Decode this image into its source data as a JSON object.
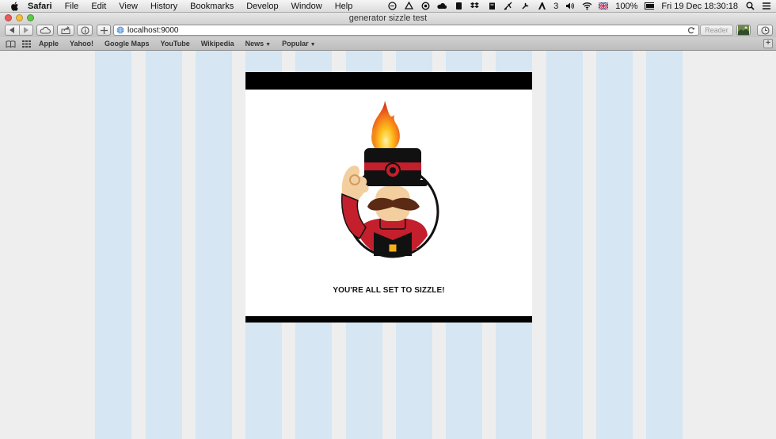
{
  "menubar": {
    "app": "Safari",
    "items": [
      "File",
      "Edit",
      "View",
      "History",
      "Bookmarks",
      "Develop",
      "Window",
      "Help"
    ],
    "status": {
      "notifications_count": "3",
      "battery": "100%",
      "datetime": "Fri 19 Dec  18:30:18"
    }
  },
  "window": {
    "title": "generator sizzle test"
  },
  "toolbar": {
    "url": "localhost:9000",
    "reader_label": "Reader"
  },
  "bookmarks": {
    "items": [
      {
        "label": "Apple"
      },
      {
        "label": "Yahoo!"
      },
      {
        "label": "Google Maps"
      },
      {
        "label": "YouTube"
      },
      {
        "label": "Wikipedia"
      },
      {
        "label": "News"
      },
      {
        "label": "Popular"
      }
    ]
  },
  "page": {
    "message": "YOU'RE ALL SET TO SIZZLE!",
    "colors": {
      "stripe": "#d6e6f3",
      "background": "#eeeeee",
      "card_border": "#000000"
    }
  }
}
